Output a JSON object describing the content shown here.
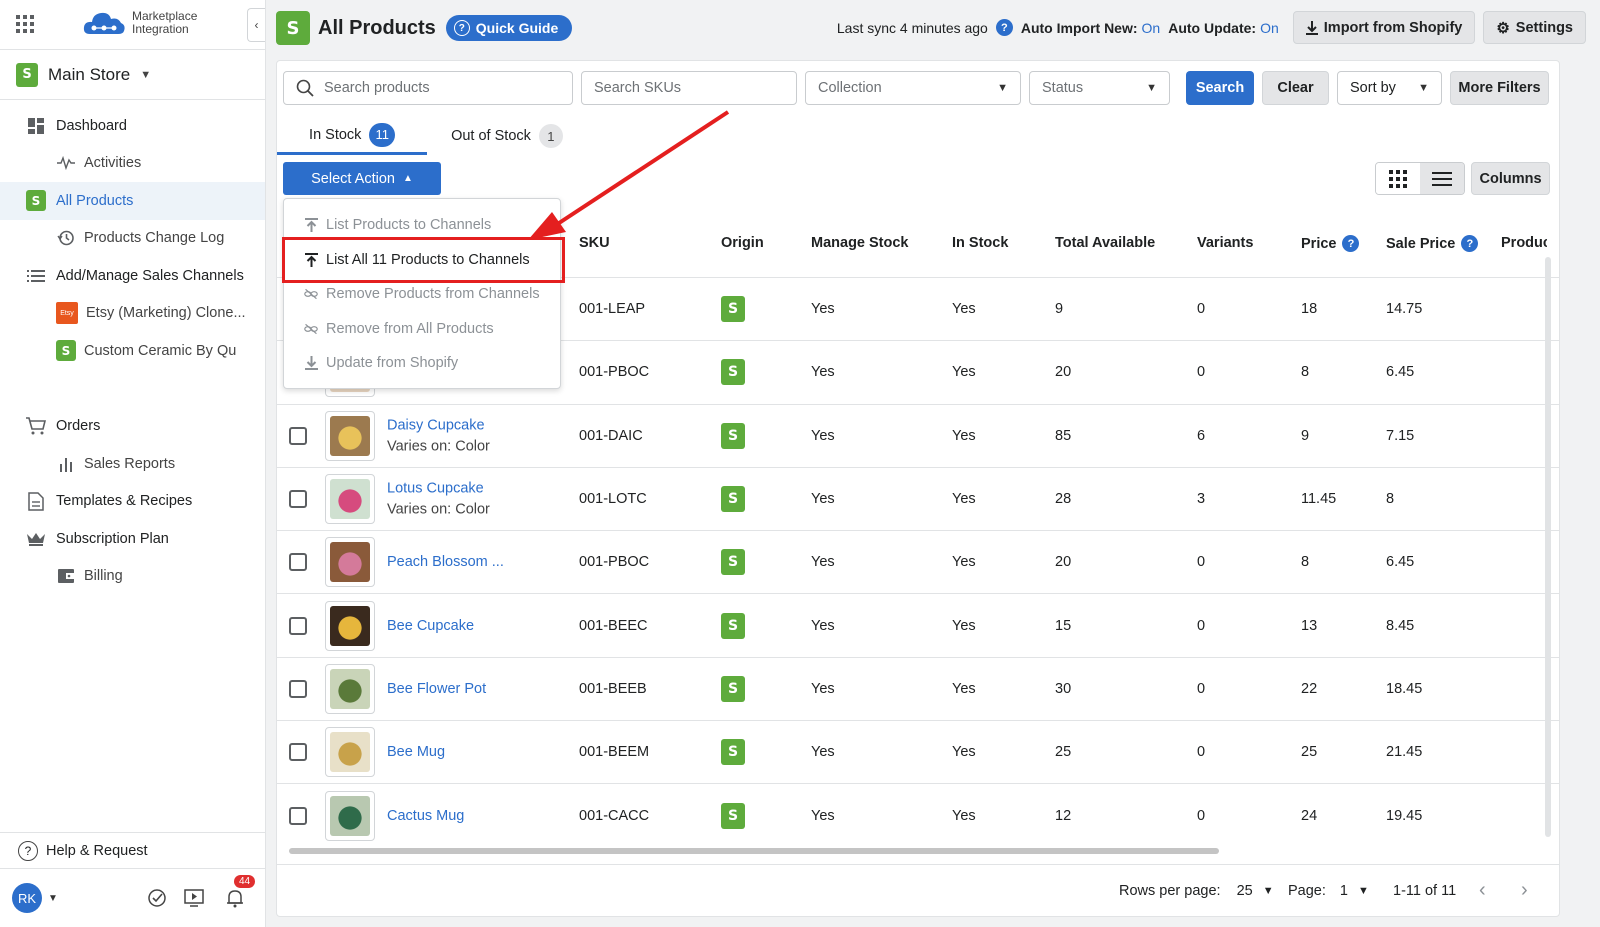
{
  "sidebar": {
    "logo_line1": "Marketplace",
    "logo_line2": "Integration",
    "collapse_label": "‹",
    "store_name": "Main Store",
    "items": [
      {
        "label": "Dashboard",
        "icon": "dashboard-icon",
        "level": "main"
      },
      {
        "label": "Activities",
        "icon": "pulse-icon",
        "level": "sub"
      },
      {
        "label": "All Products",
        "icon": "shopify-icon",
        "level": "main",
        "active": true
      },
      {
        "label": "Products Change Log",
        "icon": "history-icon",
        "level": "sub"
      },
      {
        "label": "Add/Manage Sales Channels",
        "icon": "list-icon",
        "level": "main"
      },
      {
        "label": "Etsy (Marketing) Clone...",
        "icon": "etsy-icon",
        "level": "sub"
      },
      {
        "label": "Custom Ceramic By Qu",
        "icon": "shopify-icon",
        "level": "sub"
      },
      {
        "label": "Orders",
        "icon": "cart-icon",
        "level": "main"
      },
      {
        "label": "Sales Reports",
        "icon": "bar-chart-icon",
        "level": "sub"
      },
      {
        "label": "Templates & Recipes",
        "icon": "document-icon",
        "level": "main"
      },
      {
        "label": "Subscription Plan",
        "icon": "crown-icon",
        "level": "main"
      },
      {
        "label": "Billing",
        "icon": "wallet-icon",
        "level": "sub"
      }
    ],
    "etsy_badge": "Etsy",
    "help_label": "Help & Request",
    "user_initials": "RK",
    "notification_count": "44"
  },
  "header": {
    "title": "All Products",
    "quick_guide": "Quick Guide",
    "sync_text": "Last sync 4 minutes ago",
    "auto_import_label": "Auto Import New:",
    "auto_import_value": "On",
    "auto_update_label": "Auto Update:",
    "auto_update_value": "On",
    "import_button": "Import from Shopify",
    "settings_button": "Settings"
  },
  "filters": {
    "search_products_placeholder": "Search products",
    "search_skus_placeholder": "Search SKUs",
    "collection_placeholder": "Collection",
    "status_placeholder": "Status",
    "search_button": "Search",
    "clear_button": "Clear",
    "sort_by": "Sort by",
    "more_filters": "More Filters"
  },
  "tabs": [
    {
      "label": "In Stock",
      "count": "11",
      "active": true
    },
    {
      "label": "Out of Stock",
      "count": "1",
      "active": false
    }
  ],
  "toolbar": {
    "select_action": "Select Action",
    "columns_button": "Columns"
  },
  "menu": {
    "items": [
      {
        "label": "List Products to Channels",
        "icon": "upload-icon",
        "enabled": false
      },
      {
        "label": "List All 11 Products to Channels",
        "icon": "upload-icon",
        "enabled": true
      },
      {
        "label": "Remove Products from Channels",
        "icon": "unlink-icon",
        "enabled": false
      },
      {
        "label": "Remove from All Products",
        "icon": "unlink-icon",
        "enabled": false
      },
      {
        "label": "Update from Shopify",
        "icon": "download-icon",
        "enabled": false
      }
    ]
  },
  "table": {
    "columns": [
      "SKU",
      "Origin",
      "Manage Stock",
      "In Stock",
      "Total Available",
      "Variants",
      "Price",
      "Sale Price",
      "Product"
    ],
    "rows": [
      {
        "name": "",
        "variant": "",
        "sku": "001-LEAP",
        "manage_stock": "Yes",
        "in_stock": "Yes",
        "total": "9",
        "variants": "0",
        "price": "18",
        "sale_price": "14.75"
      },
      {
        "name": "",
        "variant": "",
        "sku": "001-PBOC",
        "manage_stock": "Yes",
        "in_stock": "Yes",
        "total": "20",
        "variants": "0",
        "price": "8",
        "sale_price": "6.45"
      },
      {
        "name": "Daisy Cupcake",
        "variant": "Varies on: Color",
        "sku": "001-DAIC",
        "manage_stock": "Yes",
        "in_stock": "Yes",
        "total": "85",
        "variants": "6",
        "price": "9",
        "sale_price": "7.15"
      },
      {
        "name": "Lotus Cupcake",
        "variant": "Varies on: Color",
        "sku": "001-LOTC",
        "manage_stock": "Yes",
        "in_stock": "Yes",
        "total": "28",
        "variants": "3",
        "price": "11.45",
        "sale_price": "8"
      },
      {
        "name": "Peach Blossom ...",
        "variant": "",
        "sku": "001-PBOC",
        "manage_stock": "Yes",
        "in_stock": "Yes",
        "total": "20",
        "variants": "0",
        "price": "8",
        "sale_price": "6.45"
      },
      {
        "name": "Bee Cupcake",
        "variant": "",
        "sku": "001-BEEC",
        "manage_stock": "Yes",
        "in_stock": "Yes",
        "total": "15",
        "variants": "0",
        "price": "13",
        "sale_price": "8.45"
      },
      {
        "name": "Bee Flower Pot",
        "variant": "",
        "sku": "001-BEEB",
        "manage_stock": "Yes",
        "in_stock": "Yes",
        "total": "30",
        "variants": "0",
        "price": "22",
        "sale_price": "18.45"
      },
      {
        "name": "Bee Mug",
        "variant": "",
        "sku": "001-BEEM",
        "manage_stock": "Yes",
        "in_stock": "Yes",
        "total": "25",
        "variants": "0",
        "price": "25",
        "sale_price": "21.45"
      },
      {
        "name": "Cactus Mug",
        "variant": "",
        "sku": "001-CACC",
        "manage_stock": "Yes",
        "in_stock": "Yes",
        "total": "12",
        "variants": "0",
        "price": "24",
        "sale_price": "19.45"
      }
    ]
  },
  "pagination": {
    "rows_per_page_label": "Rows per page:",
    "rows_per_page": "25",
    "page_label": "Page:",
    "page": "1",
    "range": "1-11 of 11"
  },
  "colors": {
    "accent": "#2c6ecb",
    "shopify_green": "#5eab3c",
    "annotation_red": "#e41f1f"
  }
}
